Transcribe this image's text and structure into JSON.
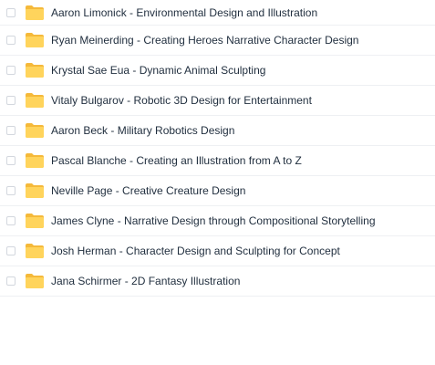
{
  "colors": {
    "folder_back": "#f5b93a",
    "folder_front": "#ffd45c",
    "text": "#1f2d3d",
    "row_divider": "#eef0f3",
    "checkbox_border": "#d3d7de"
  },
  "icons": {
    "checkbox": "checkbox-icon",
    "folder": "folder-icon"
  },
  "files": [
    {
      "name": "Aaron Limonick - Environmental Design and Illustration"
    },
    {
      "name": "Ryan Meinerding - Creating Heroes Narrative Character Design"
    },
    {
      "name": "Krystal Sae Eua - Dynamic Animal Sculpting"
    },
    {
      "name": "Vitaly Bulgarov - Robotic 3D Design for Entertainment"
    },
    {
      "name": "Aaron Beck - Military Robotics Design"
    },
    {
      "name": "Pascal Blanche - Creating an Illustration from A to Z"
    },
    {
      "name": "Neville Page - Creative Creature Design"
    },
    {
      "name": "James Clyne - Narrative Design through Compositional Storytelling"
    },
    {
      "name": "Josh Herman - Character Design and Sculpting for Concept"
    },
    {
      "name": "Jana Schirmer - 2D Fantasy Illustration"
    }
  ]
}
